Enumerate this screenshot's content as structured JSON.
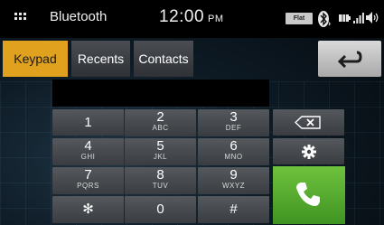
{
  "status_bar": {
    "title": "Bluetooth",
    "time": "12:00",
    "ampm": "PM",
    "eq_badge": "Flat",
    "icons": [
      "apps-grid-icon",
      "bluetooth-icon",
      "battery-icon",
      "signal-icon",
      "volume-icon"
    ]
  },
  "tabs": [
    {
      "label": "Keypad",
      "active": true
    },
    {
      "label": "Recents",
      "active": false
    },
    {
      "label": "Contacts",
      "active": false
    }
  ],
  "back_icon": "return-arrow-icon",
  "number_display": "",
  "keys": [
    {
      "digit": "1",
      "letters": ""
    },
    {
      "digit": "2",
      "letters": "ABC"
    },
    {
      "digit": "3",
      "letters": "DEF"
    },
    {
      "digit": "4",
      "letters": "GHI"
    },
    {
      "digit": "5",
      "letters": "JKL"
    },
    {
      "digit": "6",
      "letters": "MNO"
    },
    {
      "digit": "7",
      "letters": "PQRS"
    },
    {
      "digit": "8",
      "letters": "TUV"
    },
    {
      "digit": "9",
      "letters": "WXYZ"
    },
    {
      "digit": "✻",
      "letters": ""
    },
    {
      "digit": "0",
      "letters": ""
    },
    {
      "digit": "#",
      "letters": ""
    }
  ],
  "function_keys": [
    "backspace-icon",
    "settings-gear-icon",
    "call-phone-icon"
  ],
  "colors": {
    "active_tab": "#e0a11e",
    "call_button": "#4fa92c",
    "key": "#474a4e"
  }
}
